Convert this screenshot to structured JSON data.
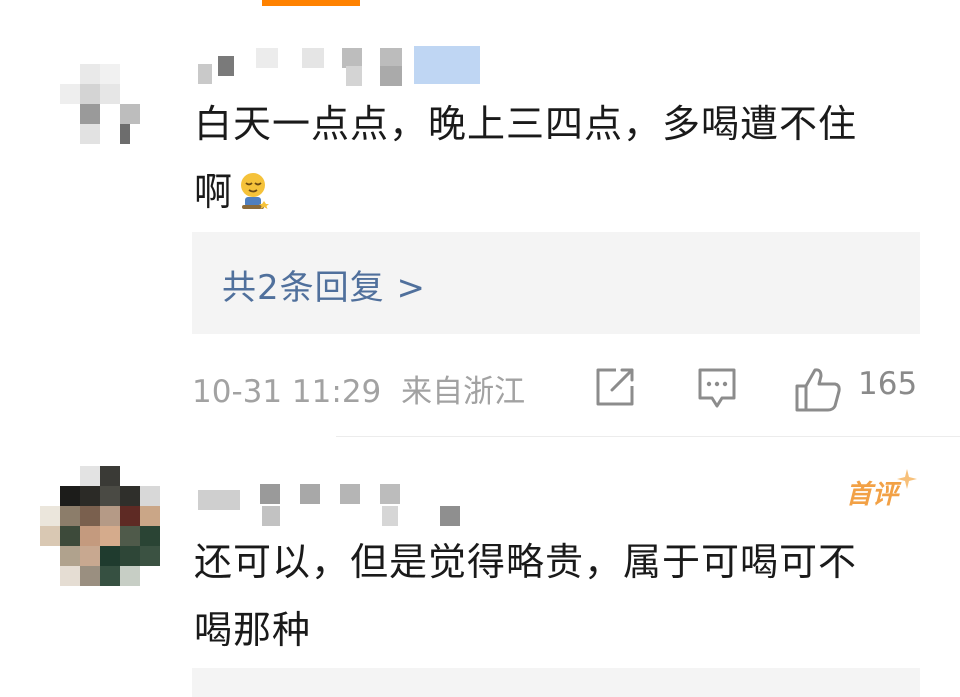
{
  "comments": [
    {
      "text_line1": "白天一点点，晚上三四点，多喝遭不住",
      "text_line2": "啊",
      "emoji": "sleepy-face-emoji",
      "reply_link": "共2条回复 >",
      "date": "10-31 11:29",
      "location": "来自浙江",
      "like_count": "165"
    },
    {
      "badge": "首评",
      "text_line1": "还可以，但是觉得略贵，属于可喝可不",
      "text_line2": "喝那种"
    }
  ],
  "colors": {
    "accent": "#ff8200",
    "link": "#50709c",
    "meta": "#a2a2a2",
    "badge": "#f2a146"
  }
}
